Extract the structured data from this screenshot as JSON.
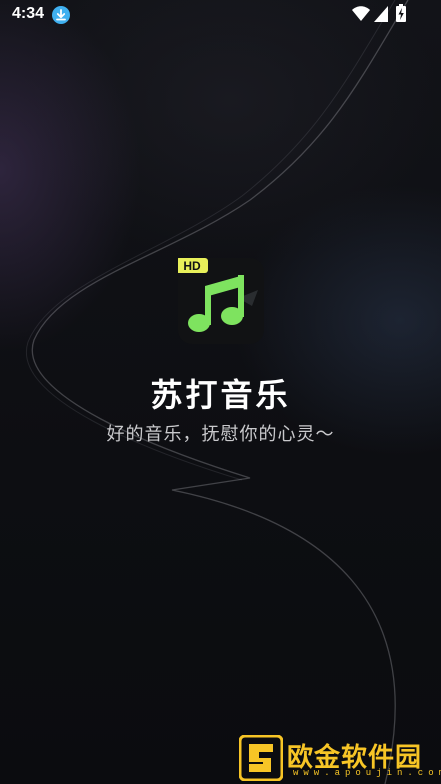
{
  "status_bar": {
    "time": "4:34",
    "notification_icon": "download-icon",
    "icons": [
      "wifi-icon",
      "cell-signal-icon",
      "battery-charging-icon"
    ]
  },
  "splash": {
    "app_icon": "music-note-hd-icon",
    "app_icon_badge": "HD",
    "app_name": "苏打音乐",
    "slogan": "好的音乐，抚慰你的心灵～"
  },
  "watermark": {
    "text": "欧金软件园",
    "subtext": "www.apoujin.com"
  },
  "colors": {
    "background": "#0d0e12",
    "accent_green": "#7ee35f",
    "badge_yellow": "#e8f05a",
    "icon_bg": "#111214",
    "watermark_gold": "#f7c526",
    "status_download": "#3fb0f0"
  }
}
